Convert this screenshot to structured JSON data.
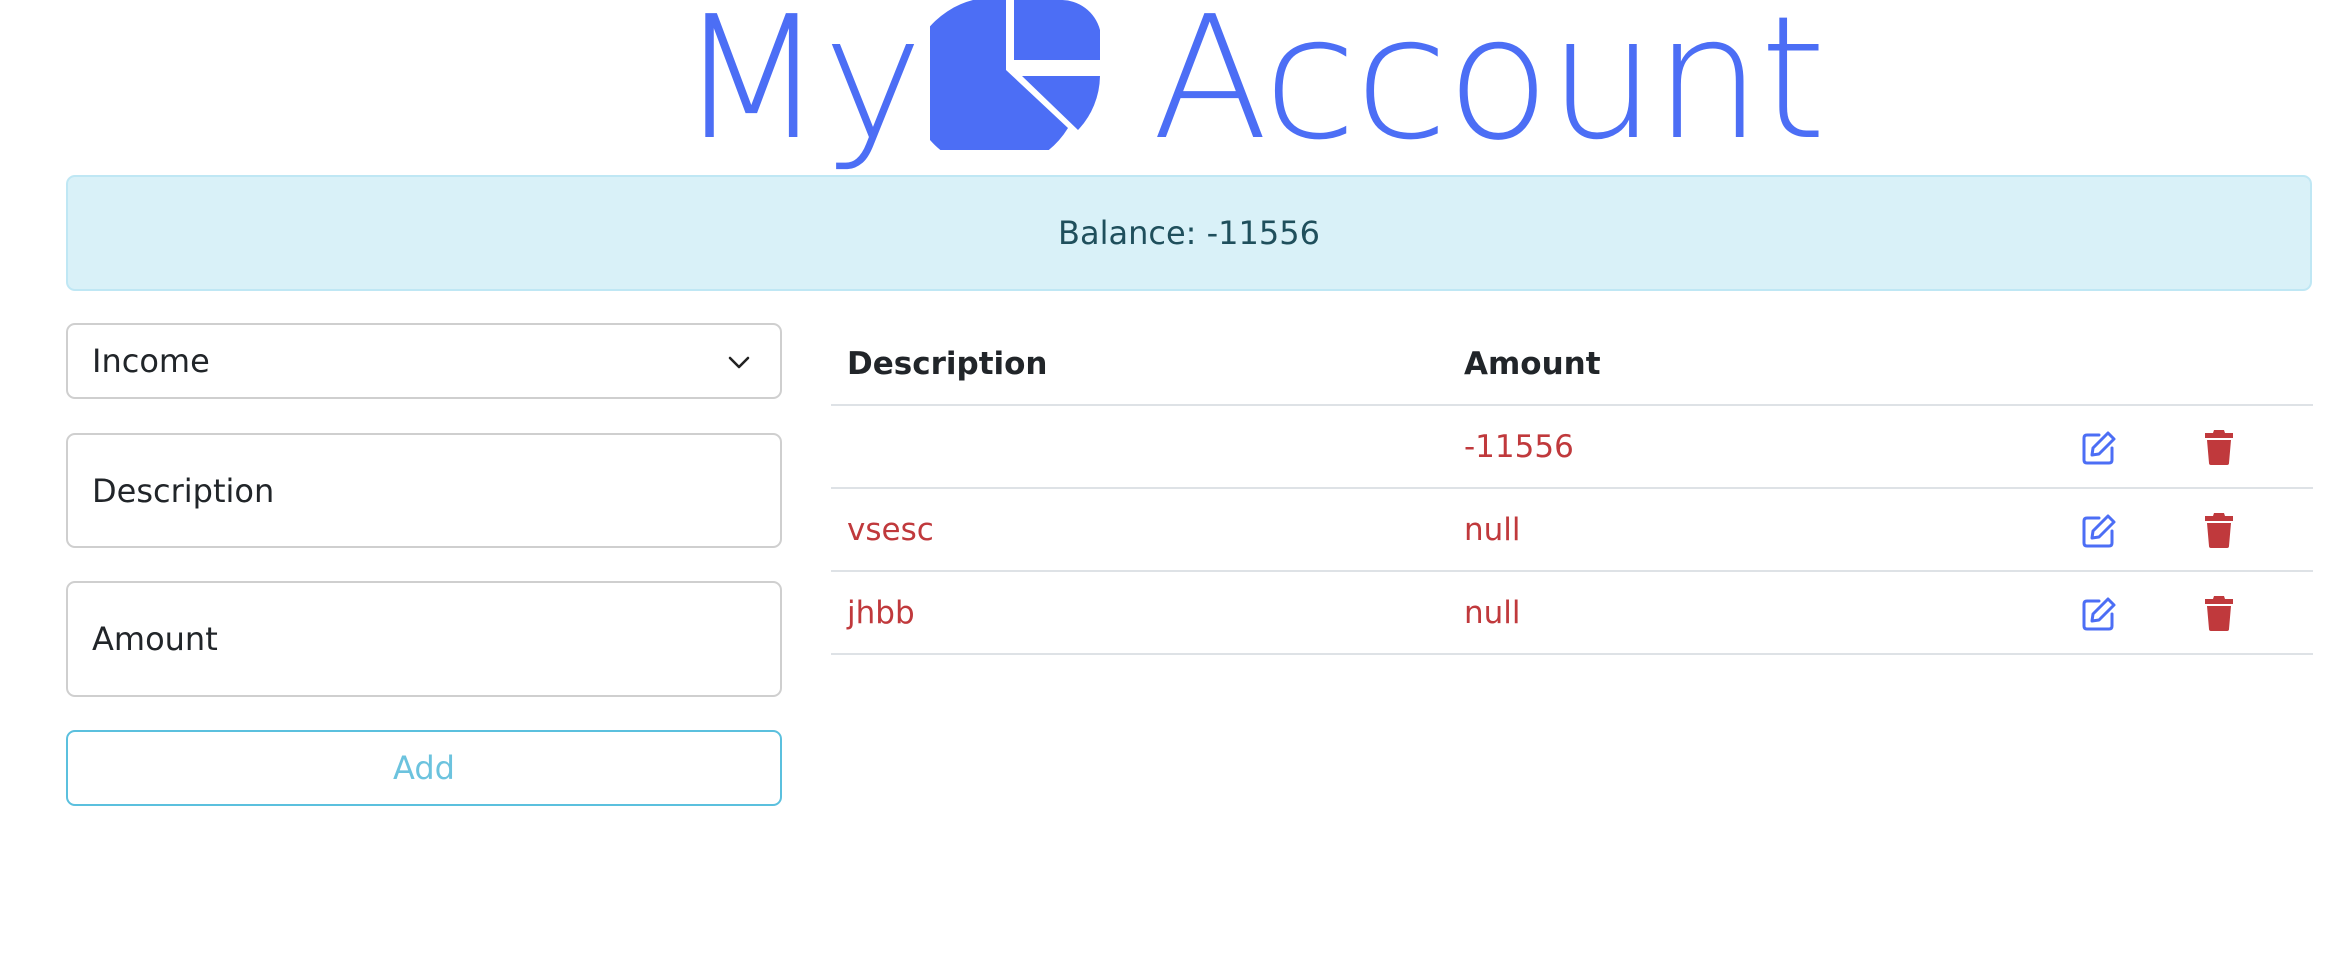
{
  "header": {
    "title_part1": "My",
    "title_icon": "pie-chart-icon",
    "title_part2": "Account"
  },
  "balance": {
    "text": "Balance: -11556"
  },
  "form": {
    "type_select_value": "Income",
    "description_placeholder": "Description",
    "amount_placeholder": "Amount",
    "add_label": "Add"
  },
  "table": {
    "headers": [
      "Description",
      "Amount"
    ],
    "rows": [
      {
        "description": "",
        "amount": "-11556"
      },
      {
        "description": "vsesc",
        "amount": "null"
      },
      {
        "description": "jhbb",
        "amount": "null"
      }
    ],
    "edit_icon": "edit-icon",
    "delete_icon": "trash-icon"
  },
  "colors": {
    "accent": "#4c6ef5",
    "danger": "#c0393c",
    "info_bg": "#d9f1f8",
    "info_border": "#5bc0de"
  }
}
